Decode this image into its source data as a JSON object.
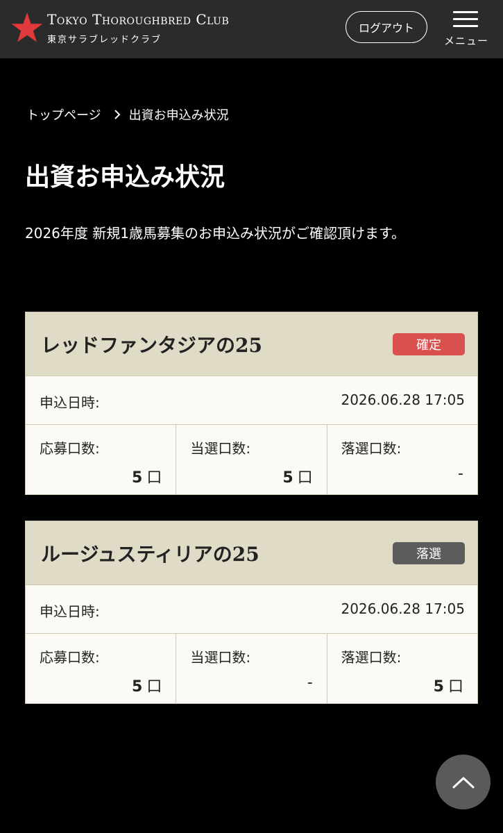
{
  "header": {
    "title": "Tokyo Thoroughbred Club",
    "subtitle": "東京サラブレッドクラブ",
    "logout_label": "ログアウト",
    "menu_label": "メニュー"
  },
  "colors": {
    "star": "#e0383b",
    "confirmed": "#d9514e",
    "rejected": "#5c5c5c",
    "card_head": "#e0dbc7"
  },
  "breadcrumb": {
    "home": "トップページ",
    "current": "出資お申込み状況"
  },
  "page": {
    "title": "出資お申込み状況",
    "description": "2026年度 新規1歳馬募集のお申込み状況がご確認頂けます。"
  },
  "applications": [
    {
      "horse": "レッドファンタジアの25",
      "status": "確定",
      "date_label": "申込日時:",
      "date": "2026.06.28 17:05",
      "applied_label": "応募口数:",
      "applied": "5",
      "won_label": "当選口数:",
      "won": "5",
      "lost_label": "落選口数:",
      "lost": "-",
      "unit": "口"
    },
    {
      "horse": "ルージュスティリアの25",
      "status": "落選",
      "date_label": "申込日時:",
      "date": "2026.06.28 17:05",
      "applied_label": "応募口数:",
      "applied": "5",
      "won_label": "当選口数:",
      "won": "-",
      "lost_label": "落選口数:",
      "lost": "5",
      "unit": "口"
    }
  ],
  "icons": {
    "logo": "star-icon",
    "menu": "hamburger-icon",
    "breadcrumb_separator": "chevron-right-icon",
    "scroll_top": "chevron-up-icon"
  }
}
